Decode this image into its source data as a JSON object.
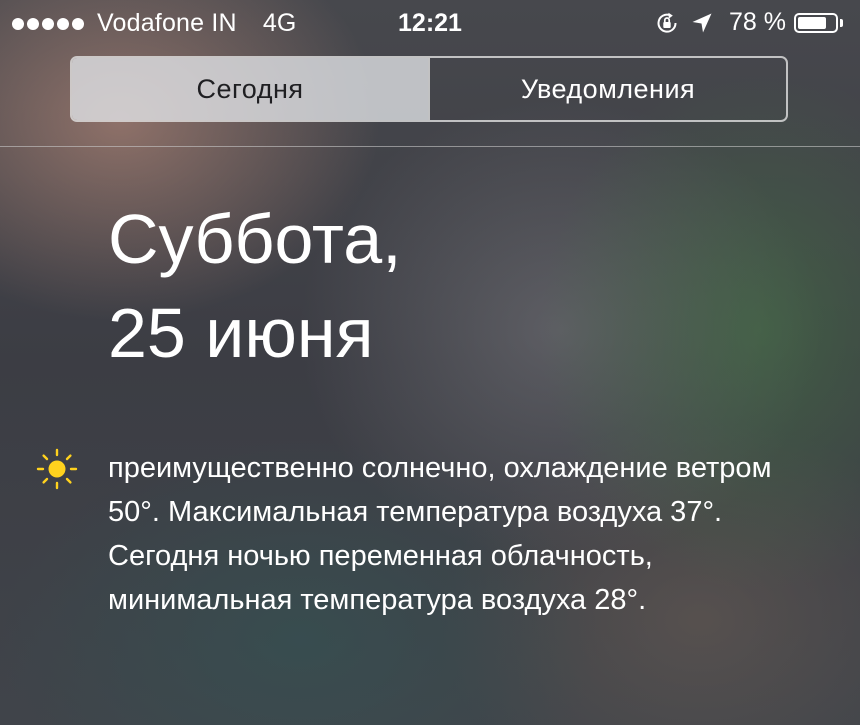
{
  "status_bar": {
    "signal_icon": "signal-dots-icon",
    "carrier": "Vodafone IN",
    "network": "4G",
    "time": "12:21",
    "rotation_lock_icon": "rotation-lock-icon",
    "location_icon": "location-arrow-icon",
    "battery_percent": "78 %",
    "battery_level": 0.78
  },
  "segmented_control": {
    "tabs": [
      {
        "label": "Сегодня",
        "selected": true
      },
      {
        "label": "Уведомления",
        "selected": false
      }
    ]
  },
  "date": {
    "weekday": "Суббота,",
    "day": "25 июня"
  },
  "weather": {
    "icon": "sun-icon",
    "icon_color": "#ffd21e",
    "summary": "преимущественно солнечно, охлаждение ветром 50°. Максимальная температура воздуха 37°. Сегодня ночью переменная облачность, минимальная температура воздуха 28°."
  }
}
